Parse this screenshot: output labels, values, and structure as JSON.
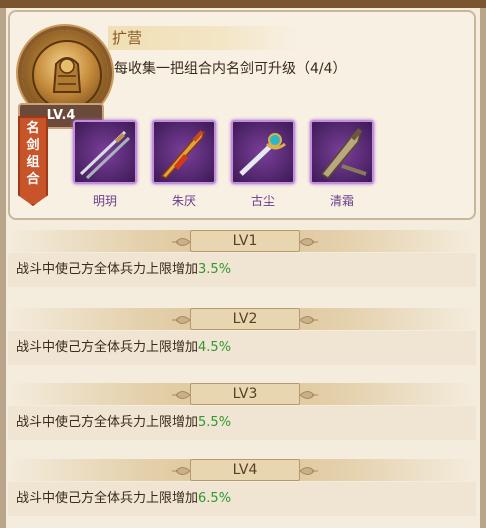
{
  "card": {
    "title": "扩营",
    "description": "每收集一把组合内名剑可升级（4/4）",
    "level_badge": "LV.4",
    "ribbon_label": "名剑组合"
  },
  "swords": [
    {
      "name": "明玥"
    },
    {
      "name": "朱厌"
    },
    {
      "name": "古尘"
    },
    {
      "name": "清霜"
    }
  ],
  "levels": [
    {
      "label": "LV1",
      "effect": "战斗中使己方全体兵力上限增加",
      "value": "3.5%"
    },
    {
      "label": "LV2",
      "effect": "战斗中使己方全体兵力上限增加",
      "value": "4.5%"
    },
    {
      "label": "LV3",
      "effect": "战斗中使己方全体兵力上限增加",
      "value": "5.5%"
    },
    {
      "label": "LV4",
      "effect": "战斗中使己方全体兵力上限增加",
      "value": "6.5%"
    }
  ],
  "colors": {
    "value_green": "#2f9a2f",
    "sword_frame": "#c58de0",
    "ribbon": "#c8552a"
  }
}
